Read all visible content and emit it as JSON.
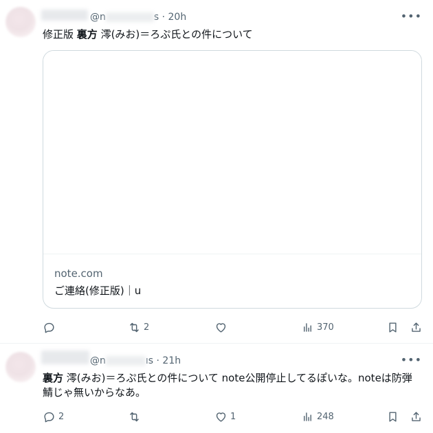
{
  "tweets": [
    {
      "handle_prefix": "@n",
      "handle_suffix": "s",
      "time": "· 20h",
      "text_pre": "修正版 ",
      "text_bold": "裏方",
      "text_post": " 澪(みお)＝ろぷ氏との件について",
      "card": {
        "domain": "note.com",
        "title": "ご連絡(修正版)｜u"
      },
      "actions": {
        "reply": "",
        "retweet": "2",
        "like": "",
        "views": "370"
      }
    },
    {
      "handle_prefix": "@n",
      "handle_suffix": "ıs",
      "time": "· 21h",
      "text_pre": "",
      "text_bold": "裏方",
      "text_post": " 澪(みお)＝ろぷ氏との件について note公開停止してるぽいな。noteは防弾鯖じゃ無いからなあ。",
      "actions": {
        "reply": "2",
        "retweet": "",
        "like": "1",
        "views": "248"
      }
    }
  ],
  "icons": {
    "more": "more-horizontal-icon",
    "reply": "reply-icon",
    "retweet": "retweet-icon",
    "like": "heart-icon",
    "views": "views-icon",
    "bookmark": "bookmark-icon",
    "share": "share-icon"
  }
}
